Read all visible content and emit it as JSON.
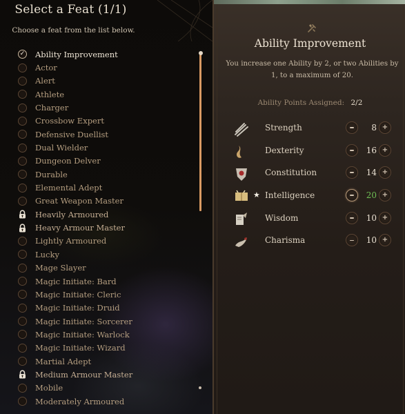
{
  "feat_panel": {
    "title": "Select a Feat (1/1)",
    "subtitle": "Choose a feat from the list below.",
    "feats": [
      {
        "label": "Ability Improvement",
        "state": "selected"
      },
      {
        "label": "Actor",
        "state": "available"
      },
      {
        "label": "Alert",
        "state": "available"
      },
      {
        "label": "Athlete",
        "state": "available"
      },
      {
        "label": "Charger",
        "state": "available"
      },
      {
        "label": "Crossbow Expert",
        "state": "available"
      },
      {
        "label": "Defensive Duellist",
        "state": "available"
      },
      {
        "label": "Dual Wielder",
        "state": "available"
      },
      {
        "label": "Dungeon Delver",
        "state": "available"
      },
      {
        "label": "Durable",
        "state": "available"
      },
      {
        "label": "Elemental Adept",
        "state": "available"
      },
      {
        "label": "Great Weapon Master",
        "state": "available"
      },
      {
        "label": "Heavily Armoured",
        "state": "locked"
      },
      {
        "label": "Heavy Armour Master",
        "state": "locked"
      },
      {
        "label": "Lightly Armoured",
        "state": "available"
      },
      {
        "label": "Lucky",
        "state": "available"
      },
      {
        "label": "Mage Slayer",
        "state": "available"
      },
      {
        "label": "Magic Initiate: Bard",
        "state": "available"
      },
      {
        "label": "Magic Initiate: Cleric",
        "state": "available"
      },
      {
        "label": "Magic Initiate: Druid",
        "state": "available"
      },
      {
        "label": "Magic Initiate: Sorcerer",
        "state": "available"
      },
      {
        "label": "Magic Initiate: Warlock",
        "state": "available"
      },
      {
        "label": "Magic Initiate: Wizard",
        "state": "available"
      },
      {
        "label": "Martial Adept",
        "state": "available"
      },
      {
        "label": "Medium Armour Master",
        "state": "locked"
      },
      {
        "label": "Mobile",
        "state": "available"
      },
      {
        "label": "Moderately Armoured",
        "state": "available"
      }
    ]
  },
  "detail_panel": {
    "icon": "ability-improvement-icon",
    "title": "Ability Improvement",
    "description": "You increase one Ability by 2, or two Abilities by 1, to a maximum of 20.",
    "points_label": "Ability Points Assigned:",
    "points_value": "2/2",
    "abilities": [
      {
        "name": "Strength",
        "value": "8",
        "icon": "strength-icon",
        "starred": false,
        "maxed": false,
        "minus_active": false
      },
      {
        "name": "Dexterity",
        "value": "16",
        "icon": "dexterity-icon",
        "starred": false,
        "maxed": false,
        "minus_active": false
      },
      {
        "name": "Constitution",
        "value": "14",
        "icon": "constitution-icon",
        "starred": false,
        "maxed": false,
        "minus_active": false
      },
      {
        "name": "Intelligence",
        "value": "20",
        "icon": "intelligence-icon",
        "starred": true,
        "maxed": true,
        "minus_active": true
      },
      {
        "name": "Wisdom",
        "value": "10",
        "icon": "wisdom-icon",
        "starred": false,
        "maxed": false,
        "minus_active": false
      },
      {
        "name": "Charisma",
        "value": "10",
        "icon": "charisma-icon",
        "starred": false,
        "maxed": false,
        "minus_active": false
      }
    ],
    "colors": {
      "maxed_value": "#6fbf55",
      "scrollbar": "#d99a63"
    }
  }
}
